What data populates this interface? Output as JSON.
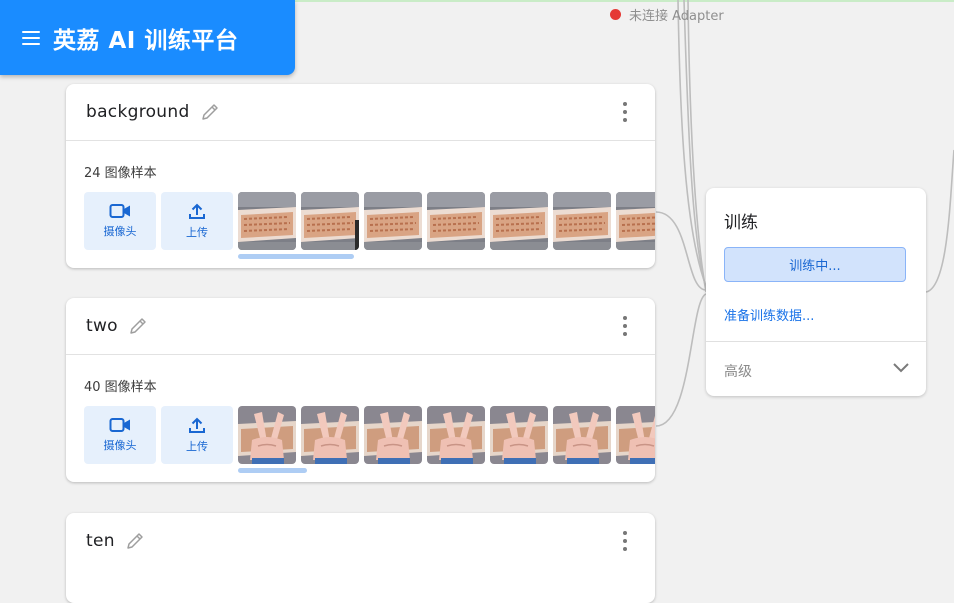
{
  "header": {
    "title": "英荔 AI 训练平台",
    "menu_icon": "menu-icon"
  },
  "status": {
    "text": "未连接 Adapter",
    "dot_color": "#e53935"
  },
  "colors": {
    "accent": "#1a8cff",
    "button_bg": "#e6f0fc",
    "link": "#1a73e8"
  },
  "classes": [
    {
      "name": "background",
      "count": "24 图像样本",
      "camera_label": "摄像头",
      "upload_label": "上传",
      "thumbnail_type": "background-scene",
      "visible_thumbnails": 7
    },
    {
      "name": "two",
      "count": "40 图像样本",
      "camera_label": "摄像头",
      "upload_label": "上传",
      "thumbnail_type": "peace-sign-hand",
      "visible_thumbnails": 7
    },
    {
      "name": "ten"
    }
  ],
  "train": {
    "title": "训练",
    "button_label": "训练中...",
    "prepare_label": "准备训练数据...",
    "advanced_label": "高级"
  }
}
